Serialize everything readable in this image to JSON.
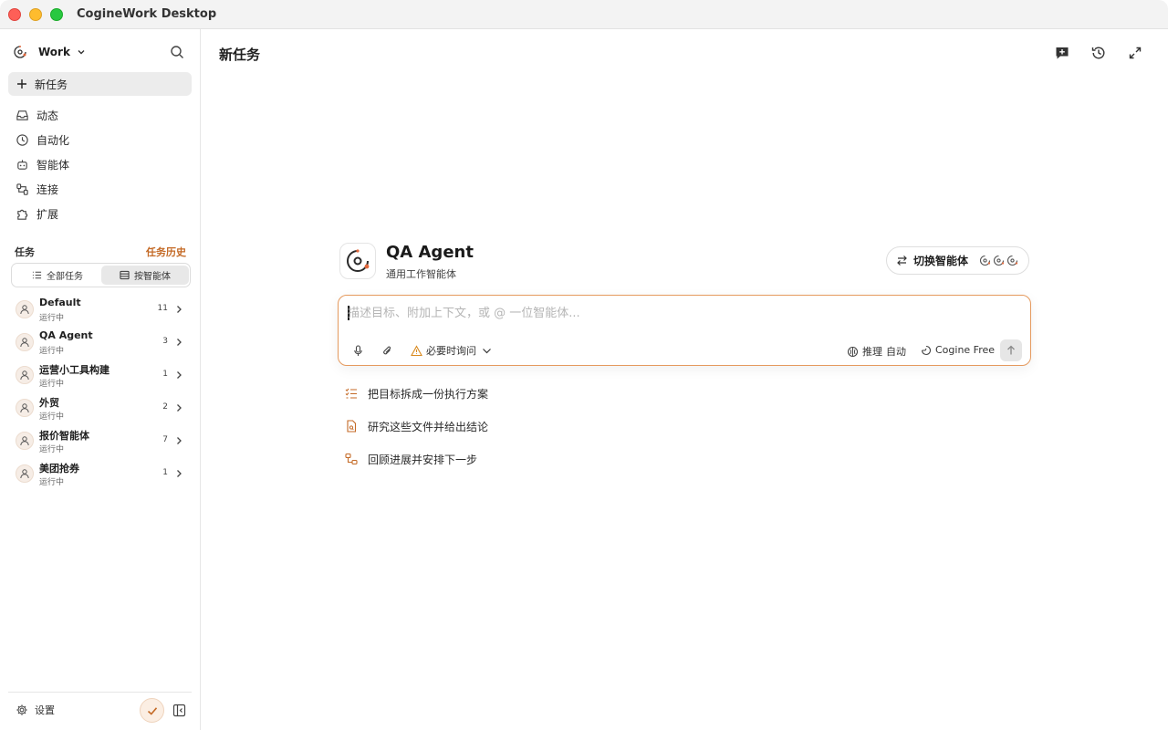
{
  "app": {
    "title": "CogineWork Desktop"
  },
  "sidebar": {
    "workspace": "Work",
    "new_task": "新任务",
    "nav": [
      {
        "label": "动态",
        "icon": "inbox-icon"
      },
      {
        "label": "自动化",
        "icon": "clock-icon"
      },
      {
        "label": "智能体",
        "icon": "robot-icon"
      },
      {
        "label": "连接",
        "icon": "connection-icon"
      },
      {
        "label": "扩展",
        "icon": "puzzle-icon"
      }
    ],
    "tasks_label": "任务",
    "history_label": "任务历史",
    "seg_all": "全部任务",
    "seg_agent": "按智能体",
    "tasks": [
      {
        "name": "Default",
        "status": "运行中",
        "count": "11"
      },
      {
        "name": "QA Agent",
        "status": "运行中",
        "count": "3"
      },
      {
        "name": "运营小工具构建",
        "status": "运行中",
        "count": "1"
      },
      {
        "name": "外贸",
        "status": "运行中",
        "count": "2"
      },
      {
        "name": "报价智能体",
        "status": "运行中",
        "count": "7"
      },
      {
        "name": "美团抢券",
        "status": "运行中",
        "count": "1"
      }
    ],
    "settings": "设置"
  },
  "main": {
    "title": "新任务",
    "agent_name": "QA Agent",
    "agent_subtitle": "通用工作智能体",
    "switch_agent": "切换智能体",
    "composer": {
      "placeholder": "描述目标、附加上下文，或 @ 一位智能体...",
      "ask_mode": "必要时询问",
      "reasoning_label": "推理",
      "reasoning_value": "自动",
      "model": "Cogine Free"
    },
    "suggestions": [
      {
        "label": "把目标拆成一份执行方案",
        "icon": "checklist-icon"
      },
      {
        "label": "研究这些文件并给出结论",
        "icon": "document-icon"
      },
      {
        "label": "回顾进展并安排下一步",
        "icon": "workflow-icon"
      }
    ]
  },
  "colors": {
    "accent": "#c46a26",
    "accent_border": "#e59a5e"
  }
}
